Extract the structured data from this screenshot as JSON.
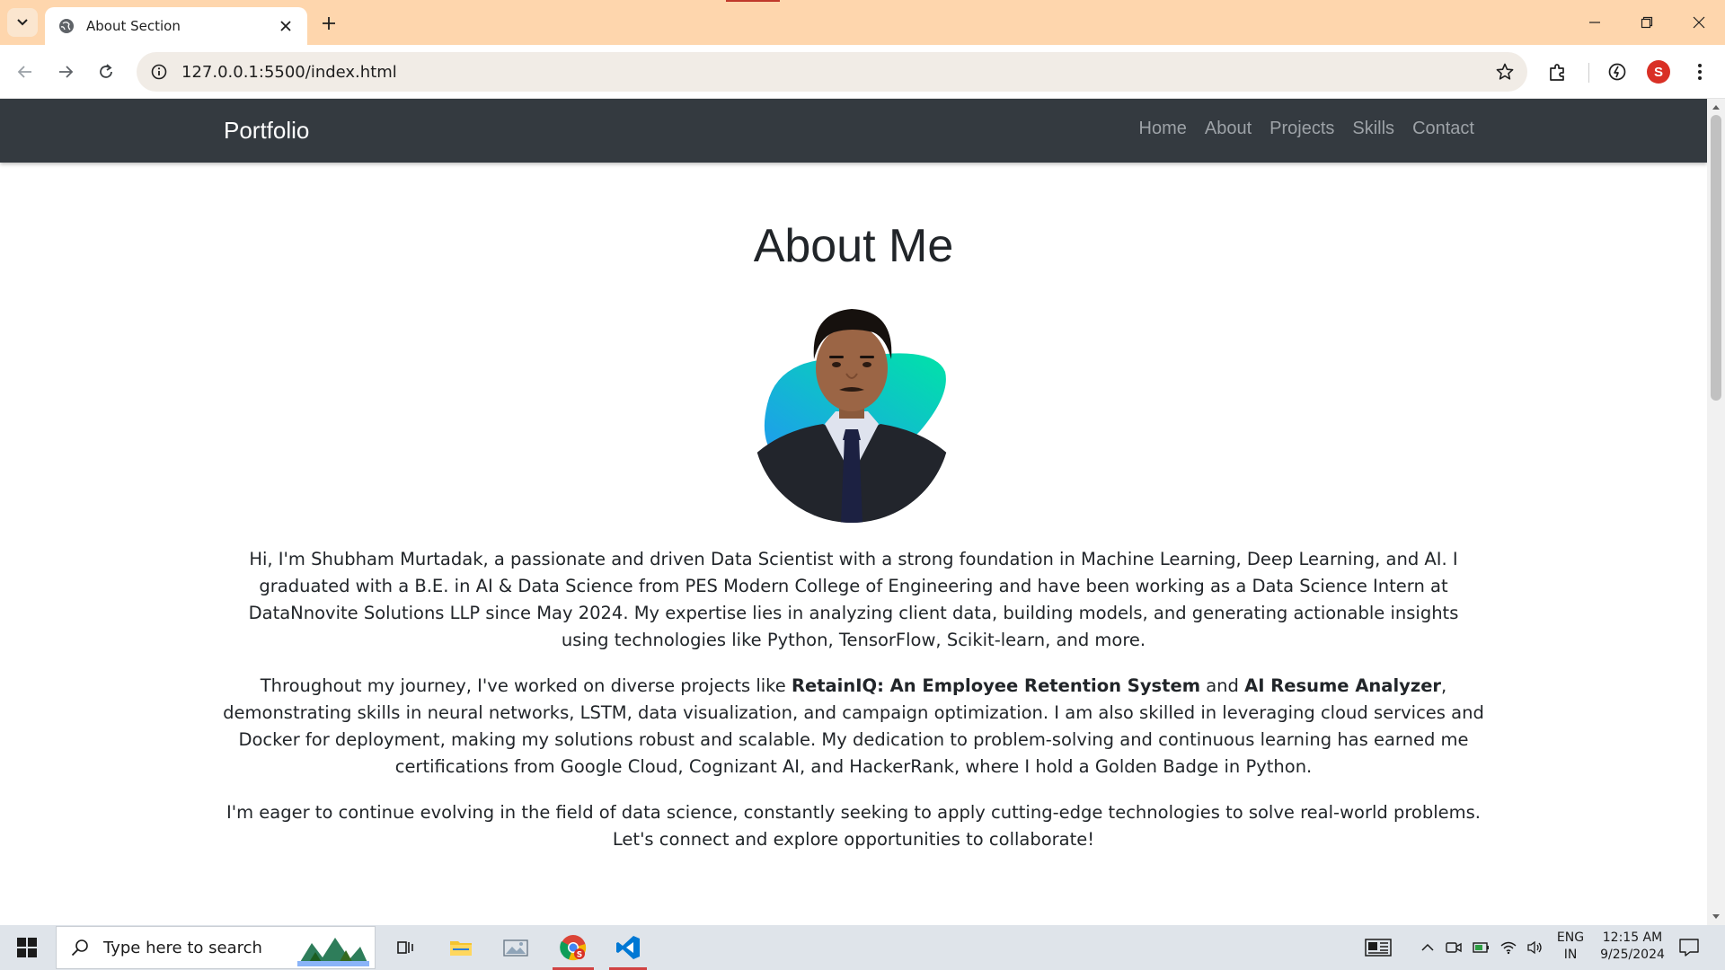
{
  "browser": {
    "tab_title": "About Section",
    "url": "127.0.0.1:5500/index.html",
    "profile_initial": "S"
  },
  "site": {
    "brand": "Portfolio",
    "nav": [
      "Home",
      "About",
      "Projects",
      "Skills",
      "Contact"
    ]
  },
  "about": {
    "title": "About Me",
    "p1": "Hi, I'm Shubham Murtadak, a passionate and driven Data Scientist with a strong foundation in Machine Learning, Deep Learning, and AI. I graduated with a B.E. in AI & Data Science from PES Modern College of Engineering and have been working as a Data Science Intern at DataNnovite Solutions LLP since May 2024. My expertise lies in analyzing client data, building models, and generating actionable insights using technologies like Python, TensorFlow, Scikit-learn, and more.",
    "p2_a": "Throughout my journey, I've worked on diverse projects like ",
    "p2_bold1": "RetainIQ: An Employee Retention System",
    "p2_b": " and ",
    "p2_bold2": "AI Resume Analyzer",
    "p2_c": ", demonstrating skills in neural networks, LSTM, data visualization, and campaign optimization. I am also skilled in leveraging cloud services and Docker for deployment, making my solutions robust and scalable. My dedication to problem-solving and continuous learning has earned me certifications from Google Cloud, Cognizant AI, and HackerRank, where I hold a Golden Badge in Python.",
    "p3": "I'm eager to continue evolving in the field of data science, constantly seeking to apply cutting-edge technologies to solve real-world problems. Let's connect and explore opportunities to collaborate!"
  },
  "taskbar": {
    "search_placeholder": "Type here to search",
    "lang": "ENG",
    "region": "IN",
    "time": "12:15 AM",
    "date": "9/25/2024"
  },
  "colors": {
    "tabstrip": "#fed6ad",
    "navbar": "#343a40",
    "text": "#212529"
  }
}
